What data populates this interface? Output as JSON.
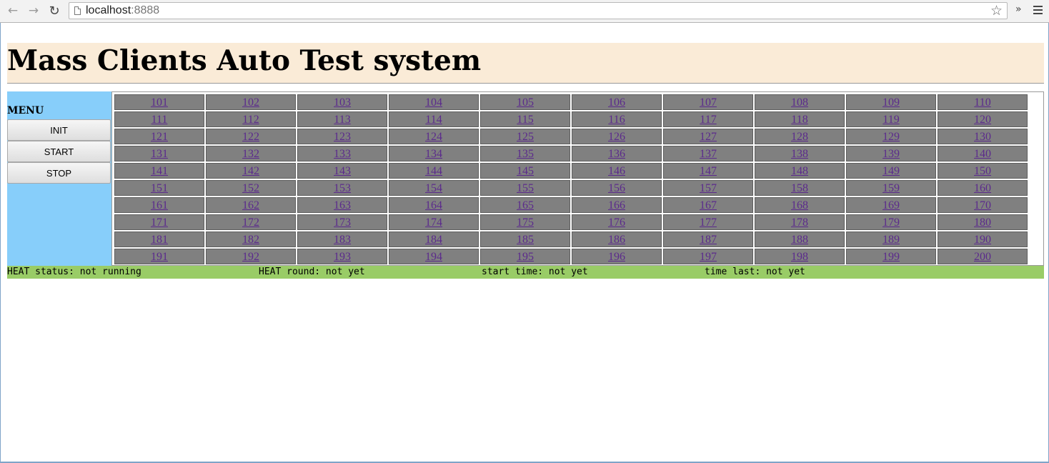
{
  "browser": {
    "url_host": "localhost",
    "url_port": ":8888"
  },
  "page": {
    "title": "Mass Clients Auto Test system"
  },
  "menu": {
    "label": "MENU",
    "buttons": [
      "INIT",
      "START",
      "STOP"
    ]
  },
  "grid": {
    "rows": [
      [
        "101",
        "102",
        "103",
        "104",
        "105",
        "106",
        "107",
        "108",
        "109",
        "110"
      ],
      [
        "111",
        "112",
        "113",
        "114",
        "115",
        "116",
        "117",
        "118",
        "119",
        "120"
      ],
      [
        "121",
        "122",
        "123",
        "124",
        "125",
        "126",
        "127",
        "128",
        "129",
        "130"
      ],
      [
        "131",
        "132",
        "133",
        "134",
        "135",
        "136",
        "137",
        "138",
        "139",
        "140"
      ],
      [
        "141",
        "142",
        "143",
        "144",
        "145",
        "146",
        "147",
        "148",
        "149",
        "150"
      ],
      [
        "151",
        "152",
        "153",
        "154",
        "155",
        "156",
        "157",
        "158",
        "159",
        "160"
      ],
      [
        "161",
        "162",
        "163",
        "164",
        "165",
        "166",
        "167",
        "168",
        "169",
        "170"
      ],
      [
        "171",
        "172",
        "173",
        "174",
        "175",
        "176",
        "177",
        "178",
        "179",
        "180"
      ],
      [
        "181",
        "182",
        "183",
        "184",
        "185",
        "186",
        "187",
        "188",
        "189",
        "190"
      ],
      [
        "191",
        "192",
        "193",
        "194",
        "195",
        "196",
        "197",
        "198",
        "199",
        "200"
      ]
    ]
  },
  "status": {
    "heat_status": "HEAT status: not running",
    "heat_round": "HEAT round: not yet",
    "start_time": "start time: not yet",
    "time_last": "time last: not yet"
  },
  "colors": {
    "title_bg": "#faebd7",
    "menu_bg": "#87cefa",
    "cell_bg": "#808080",
    "link": "#5b2a8c",
    "status_bg": "#99cc66"
  }
}
